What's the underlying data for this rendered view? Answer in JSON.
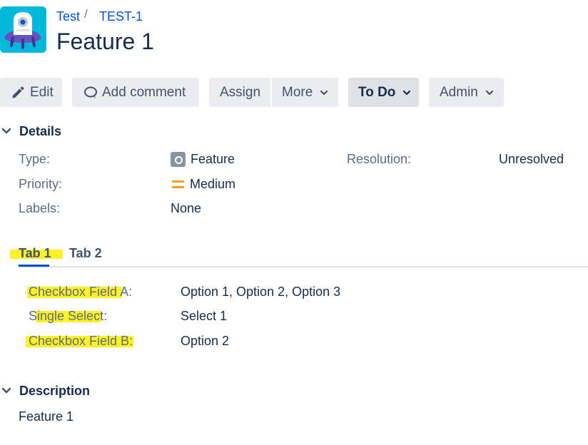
{
  "header": {
    "project_link": "Test",
    "separator": "/",
    "issue_key": "TEST-1",
    "title": "Feature 1"
  },
  "toolbar": {
    "edit": "Edit",
    "comment": "Add comment",
    "assign": "Assign",
    "more": "More",
    "status": "To Do",
    "admin": "Admin"
  },
  "details": {
    "heading": "Details",
    "type_label": "Type:",
    "type_value": "Feature",
    "priority_label": "Priority:",
    "priority_value": "Medium",
    "labels_label": "Labels:",
    "labels_value": "None",
    "resolution_label": "Resolution:",
    "resolution_value": "Unresolved"
  },
  "tabs": [
    {
      "label": "Tab 1",
      "active": true
    },
    {
      "label": "Tab 2",
      "active": false
    }
  ],
  "tab_fields": [
    {
      "label": "Checkbox Field A:",
      "value": "Option 1, Option 2, Option 3"
    },
    {
      "label": "Single Select:",
      "value": "Select 1"
    },
    {
      "label": "Checkbox Field B:",
      "value": "Option 2"
    }
  ],
  "description": {
    "heading": "Description",
    "text": "Feature 1"
  },
  "colors": {
    "link": "#0052cc",
    "highlight": "#ffef00",
    "priority_medium": "#ff991f",
    "avatar_bg": "#00b8d9"
  }
}
